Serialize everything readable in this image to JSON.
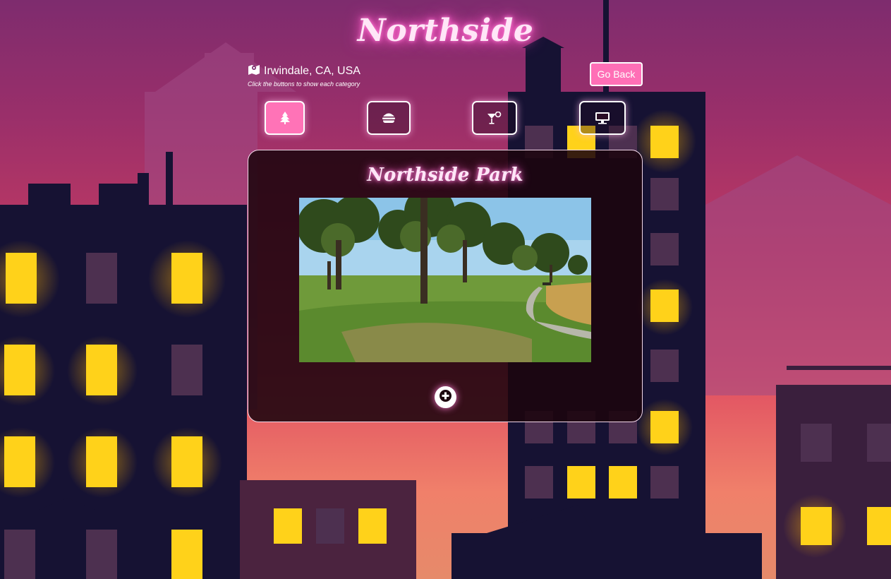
{
  "page": {
    "title": "Northside",
    "location": "Irwindale, CA, USA",
    "hint": "Click the buttons to show each category",
    "go_back_label": "Go Back"
  },
  "categories": [
    {
      "icon": "tree-icon",
      "active": true
    },
    {
      "icon": "burger-icon",
      "active": false
    },
    {
      "icon": "cocktail-icon",
      "active": false
    },
    {
      "icon": "monitor-icon",
      "active": false
    }
  ],
  "place": {
    "name": "Northside Park",
    "photo_icon": "park-photo"
  },
  "colors": {
    "accent": "#ff73b7",
    "glow": "#ff5ec8",
    "card_bg": "#1c050e",
    "window_light": "#ffd21a"
  }
}
